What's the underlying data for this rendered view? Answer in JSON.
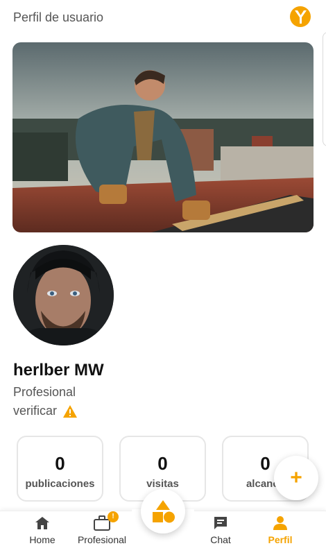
{
  "header": {
    "title": "Perfil de usuario",
    "logo_icon": "yummy-logo-icon"
  },
  "profile": {
    "cover_alt": "Roofer working on a tile roof",
    "avatar_alt": "Bearded man in dark beanie",
    "name": "herlber MW",
    "role": "Profesional",
    "verify_label": "verificar",
    "verify_icon": "warning-icon"
  },
  "stats": [
    {
      "value": "0",
      "label": "publicaciones"
    },
    {
      "value": "0",
      "label": "visitas"
    },
    {
      "value": "0",
      "label": "alcance"
    }
  ],
  "fab": {
    "icon": "plus-icon",
    "label": "+"
  },
  "nav": {
    "items": [
      {
        "label": "Home",
        "icon": "home-icon"
      },
      {
        "label": "Profesional",
        "icon": "briefcase-icon",
        "badge": "!"
      },
      {
        "label": "",
        "icon": "shapes-icon"
      },
      {
        "label": "Chat",
        "icon": "chat-icon"
      },
      {
        "label": "Perfil",
        "icon": "person-icon",
        "active": true
      }
    ]
  },
  "colors": {
    "accent": "#f5a300",
    "text_muted": "#555555",
    "card_border": "#e6e6e6"
  }
}
